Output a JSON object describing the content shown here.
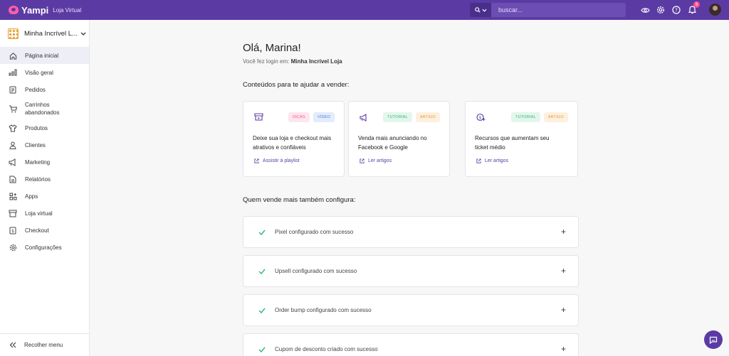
{
  "topbar": {
    "brand_name": "Yampi",
    "brand_sub": "Loja Virtual",
    "search_placeholder": "buscar...",
    "notification_count": "9"
  },
  "sidebar": {
    "store_name": "Minha Incrível L...",
    "items": [
      {
        "label": "Página inicial",
        "icon": "home-icon"
      },
      {
        "label": "Visão geral",
        "icon": "chart-icon"
      },
      {
        "label": "Pedidos",
        "icon": "orders-icon"
      },
      {
        "label": "Carrinhos abandonados",
        "icon": "cart-icon"
      },
      {
        "label": "Produtos",
        "icon": "shirt-icon"
      },
      {
        "label": "Clientes",
        "icon": "user-icon"
      },
      {
        "label": "Marketing",
        "icon": "megaphone-icon"
      },
      {
        "label": "Relatórios",
        "icon": "report-icon"
      },
      {
        "label": "Apps",
        "icon": "apps-icon"
      },
      {
        "label": "Loja virtual",
        "icon": "storefront-icon"
      },
      {
        "label": "Checkout",
        "icon": "checkout-icon"
      },
      {
        "label": "Configurações",
        "icon": "gear-icon"
      }
    ],
    "collapse_label": "Recolher menu"
  },
  "main": {
    "greeting": "Olá, Marina!",
    "login_prefix": "Você fez login em:",
    "login_store": "Minha Incrível Loja",
    "content_title": "Conteúdos para te ajudar a vender:",
    "cards": [
      {
        "text": "Deixe sua loja e checkout mais atrativos e confiáveis",
        "tags": [
          "DICAS",
          "VÍDEO"
        ],
        "link": "Assistir à playlist"
      },
      {
        "text": "Venda mais anunciando no Facebook e Google",
        "tags": [
          "TUTORIAL",
          "ARTIGO"
        ],
        "link": "Ler artigos"
      },
      {
        "text": "Recursos que aumentam seu ticket médio",
        "tags": [
          "TUTORIAL",
          "ARTIGO"
        ],
        "link": "Ler artigos"
      }
    ],
    "config_title": "Quem vende mais também configura:",
    "configs": [
      "Pixel configurado com sucesso",
      "Upsell configurado com sucesso",
      "Order bump configurado com sucesso",
      "Cupom de desconto criado com sucesso"
    ]
  },
  "colors": {
    "brand": "#5b3ba3",
    "check": "#2eb872",
    "tag_dicas": "#ff4d8d",
    "tag_video": "#4a7fd6",
    "tag_tutorial": "#2eb872",
    "tag_artigo": "#e89a2c"
  }
}
